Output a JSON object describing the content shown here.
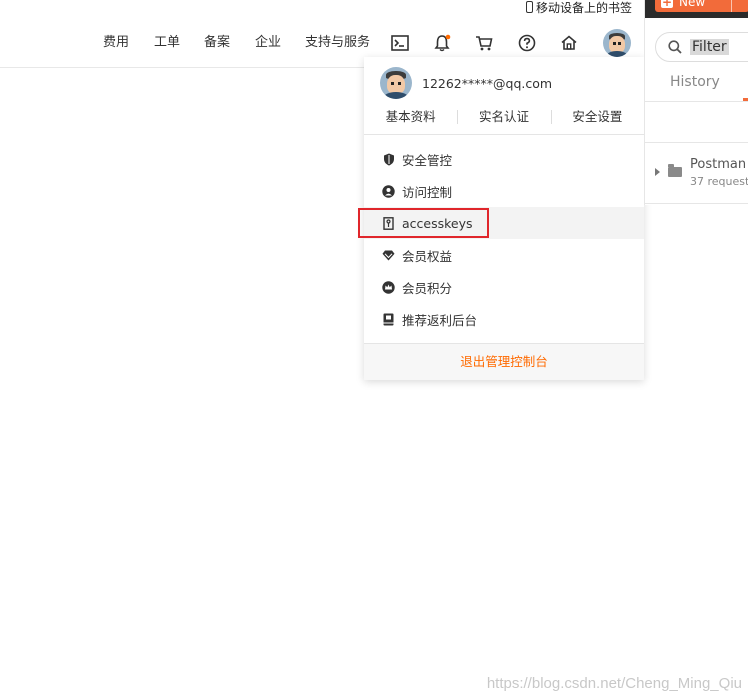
{
  "bookmark_bar": {
    "mobile_bookmarks_label": "移动设备上的书签"
  },
  "header": {
    "nav": [
      "费用",
      "工单",
      "备案",
      "企业",
      "支持与服务"
    ],
    "icons": [
      "terminal-icon",
      "bell-icon",
      "cart-icon",
      "help-icon",
      "home-icon"
    ],
    "notification_dot_color": "#ff6a00"
  },
  "dropdown": {
    "email": "12262*****@qq.com",
    "links": [
      "基本资料",
      "实名认证",
      "安全设置"
    ],
    "menu": [
      {
        "label": "安全管控",
        "icon": "shield-icon"
      },
      {
        "label": "访问控制",
        "icon": "user-circle-icon"
      },
      {
        "label": "accesskeys",
        "icon": "key-icon",
        "highlighted": true
      },
      {
        "label": "会员权益",
        "icon": "diamond-icon"
      },
      {
        "label": "会员积分",
        "icon": "crown-icon"
      },
      {
        "label": "推荐返利后台",
        "icon": "book-icon"
      }
    ],
    "logout": "退出管理控制台",
    "highlight_color": "#e0262b"
  },
  "postman": {
    "new_label": "New",
    "filter_placeholder": "Filter",
    "history_tab": "History",
    "collection_name": "Postman",
    "collection_count": "37 request",
    "accent_color": "#f26b3a"
  },
  "watermark": "https://blog.csdn.net/Cheng_Ming_Qiu"
}
